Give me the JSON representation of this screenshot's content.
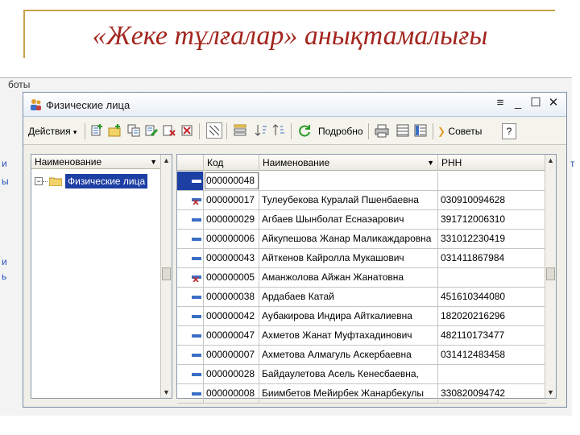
{
  "slide": {
    "title": "«Жеке тұлғалар» анықтамалығы"
  },
  "background": {
    "caption": "боты",
    "edge_left": [
      "и",
      "ы",
      "и",
      "ь"
    ],
    "edge_right": [
      "т"
    ]
  },
  "window": {
    "title": "Физические лица",
    "controls": {
      "menu": "≡",
      "minimize": "_",
      "maximize": "☐",
      "close": "✕"
    }
  },
  "toolbar": {
    "actions_label": "Действия",
    "details_label": "Подробно",
    "tips_label": "Советы",
    "help_label": "?"
  },
  "tree": {
    "header": "Наименование",
    "root_label": "Физические лица"
  },
  "grid": {
    "columns": {
      "code": "Код",
      "name": "Наименование",
      "rnn": "РНН"
    },
    "rows": [
      {
        "code": "000000048",
        "name": "",
        "rnn": "",
        "marked": false,
        "selected": true
      },
      {
        "code": "000000017",
        "name": "Тулеубекова Куралай Пшенбаевна",
        "rnn": "030910094628",
        "marked": true,
        "selected": false
      },
      {
        "code": "000000029",
        "name": "Агбаев Шынболат Еснаэарович",
        "rnn": "391712006310",
        "marked": false,
        "selected": false
      },
      {
        "code": "000000006",
        "name": "Айкупешова Жанар Маликаждаровна",
        "rnn": "331012230419",
        "marked": false,
        "selected": false
      },
      {
        "code": "000000043",
        "name": "Айткенов Кайролла Мукашович",
        "rnn": "031411867984",
        "marked": false,
        "selected": false
      },
      {
        "code": "000000005",
        "name": "Аманжолова Айжан  Жанатовна",
        "rnn": "",
        "marked": true,
        "selected": false
      },
      {
        "code": "000000038",
        "name": "Ардабаев Катай",
        "rnn": "451610344080",
        "marked": false,
        "selected": false
      },
      {
        "code": "000000042",
        "name": "Аубакирова Индира Айткалиевна",
        "rnn": "182020216296",
        "marked": false,
        "selected": false
      },
      {
        "code": "000000047",
        "name": "Ахметов Жанат Муфтахадинович",
        "rnn": "482110173477",
        "marked": false,
        "selected": false
      },
      {
        "code": "000000007",
        "name": "Ахметова Алмагуль Аскербаевна",
        "rnn": "031412483458",
        "marked": false,
        "selected": false
      },
      {
        "code": "000000028",
        "name": "Байдаулетова Асель Кенесбаевна,",
        "rnn": "",
        "marked": false,
        "selected": false
      },
      {
        "code": "000000008",
        "name": "Биимбетов Мейирбек Жанарбекулы",
        "rnn": "330820094742",
        "marked": false,
        "selected": false
      }
    ]
  },
  "colors": {
    "accent": "#1d3fa4",
    "title": "#a3251e",
    "mark": "#c0282d"
  }
}
